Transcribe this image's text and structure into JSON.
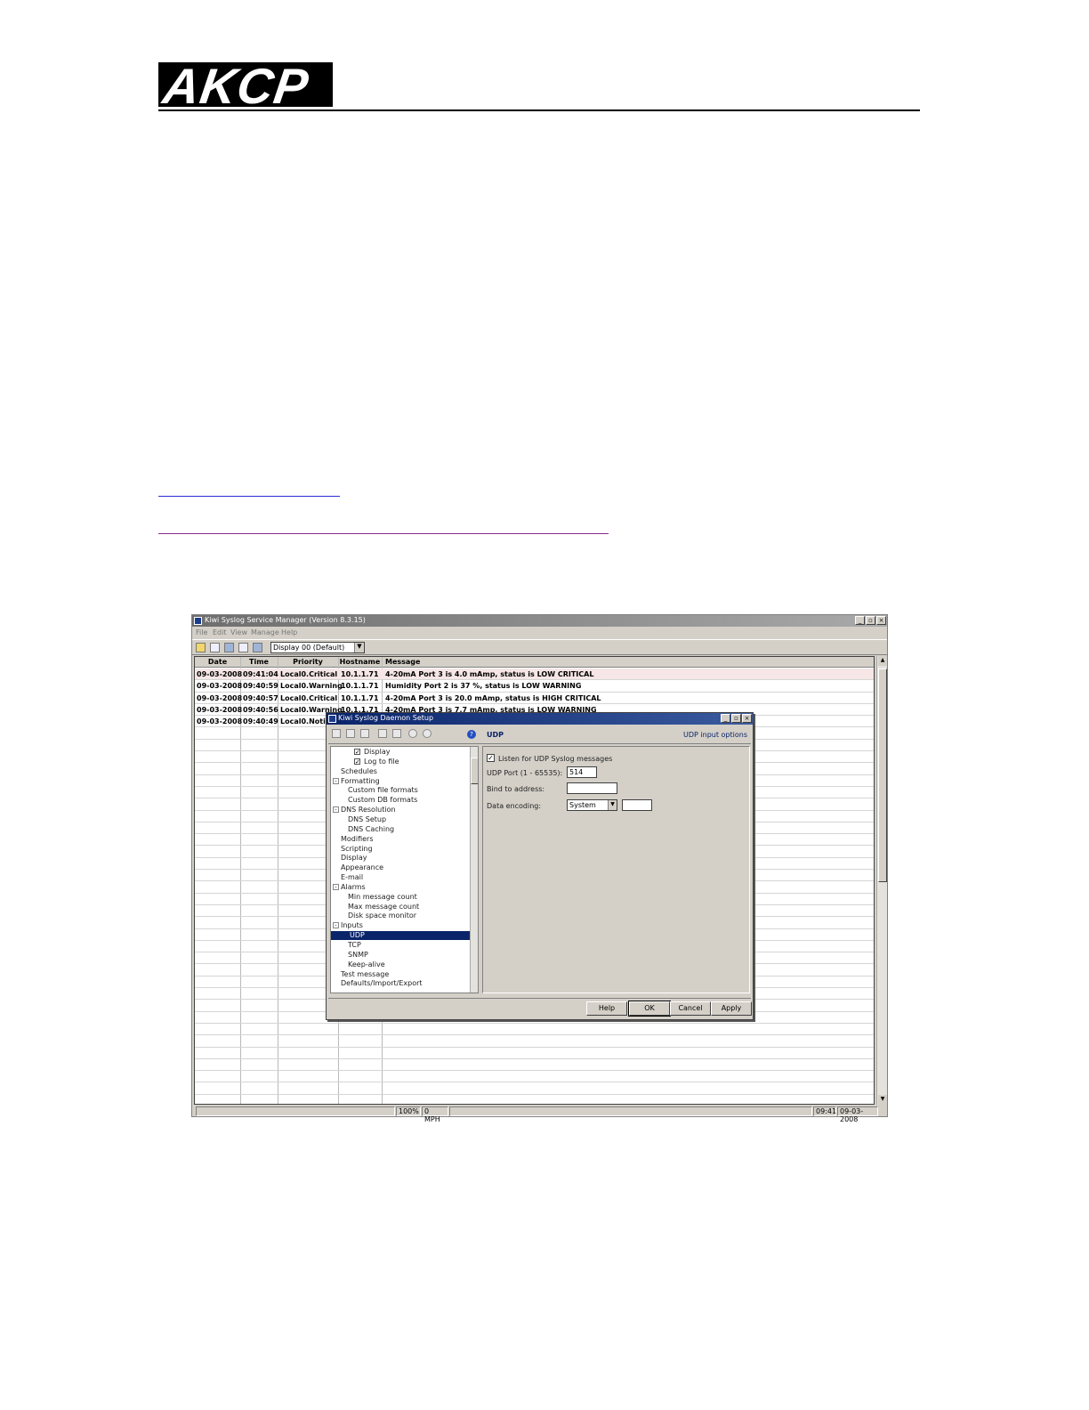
{
  "header": {
    "logo_text": "AKCP"
  },
  "app": {
    "title": "Kiwi Syslog Service Manager (Version 8.3.15)",
    "menu": [
      "File",
      "Edit",
      "View",
      "Manage",
      "Help"
    ],
    "display_select": "Display 00 (Default)",
    "columns": [
      "Date",
      "Time",
      "Priority",
      "Hostname",
      "Message"
    ],
    "rows": [
      {
        "date": "09-03-2008",
        "time": "09:41:04",
        "priority": "Local0.Critical",
        "host": "10.1.1.71",
        "message": "4-20mA Port 3 is 4.0 mAmp, status is LOW CRITICAL"
      },
      {
        "date": "09-03-2008",
        "time": "09:40:59",
        "priority": "Local0.Warning",
        "host": "10.1.1.71",
        "message": "Humidity Port 2 is 37 %, status is LOW WARNING"
      },
      {
        "date": "09-03-2008",
        "time": "09:40:57",
        "priority": "Local0.Critical",
        "host": "10.1.1.71",
        "message": "4-20mA Port 3 is 20.0 mAmp, status is HIGH CRITICAL"
      },
      {
        "date": "09-03-2008",
        "time": "09:40:56",
        "priority": "Local0.Warning",
        "host": "10.1.1.71",
        "message": "4-20mA Port 3 is 7.7 mAmp, status is LOW WARNING"
      },
      {
        "date": "09-03-2008",
        "time": "09:40:49",
        "priority": "Local0.Notice",
        "host": "",
        "message": ""
      }
    ],
    "status": {
      "zoom": "100%",
      "rate": "0 MPH",
      "time": "09:41",
      "date": "09-03-2008"
    }
  },
  "dialog": {
    "title": "Kiwi Syslog Daemon Setup",
    "section": "UDP",
    "section_hint": "UDP input options",
    "tree": [
      {
        "label": "Display",
        "indent": 3,
        "check": true
      },
      {
        "label": "Log to file",
        "indent": 3,
        "check": true
      },
      {
        "label": "Schedules",
        "indent": 1
      },
      {
        "label": "Formatting",
        "indent": 1,
        "box": "-"
      },
      {
        "label": "Custom file formats",
        "indent": 2
      },
      {
        "label": "Custom DB formats",
        "indent": 2
      },
      {
        "label": "DNS Resolution",
        "indent": 1,
        "box": "-"
      },
      {
        "label": "DNS Setup",
        "indent": 2
      },
      {
        "label": "DNS Caching",
        "indent": 2
      },
      {
        "label": "Modifiers",
        "indent": 1
      },
      {
        "label": "Scripting",
        "indent": 1
      },
      {
        "label": "Display",
        "indent": 1
      },
      {
        "label": "Appearance",
        "indent": 1
      },
      {
        "label": "E-mail",
        "indent": 1
      },
      {
        "label": "Alarms",
        "indent": 1,
        "box": "-"
      },
      {
        "label": "Min message count",
        "indent": 2
      },
      {
        "label": "Max message count",
        "indent": 2
      },
      {
        "label": "Disk space monitor",
        "indent": 2
      },
      {
        "label": "Inputs",
        "indent": 1,
        "box": "-"
      },
      {
        "label": "UDP",
        "indent": 2,
        "selected": true
      },
      {
        "label": "TCP",
        "indent": 2
      },
      {
        "label": "SNMP",
        "indent": 2
      },
      {
        "label": "Keep-alive",
        "indent": 2
      },
      {
        "label": "Test message",
        "indent": 1
      },
      {
        "label": "Defaults/Import/Export",
        "indent": 1
      }
    ],
    "listen_label": "Listen for UDP Syslog messages",
    "port_label": "UDP Port (1 - 65535):",
    "port_value": "514",
    "bind_label": "Bind to address:",
    "bind_value": "",
    "encoding_label": "Data encoding:",
    "encoding_value": "System",
    "buttons": {
      "help": "Help",
      "ok": "OK",
      "cancel": "Cancel",
      "apply": "Apply"
    }
  }
}
